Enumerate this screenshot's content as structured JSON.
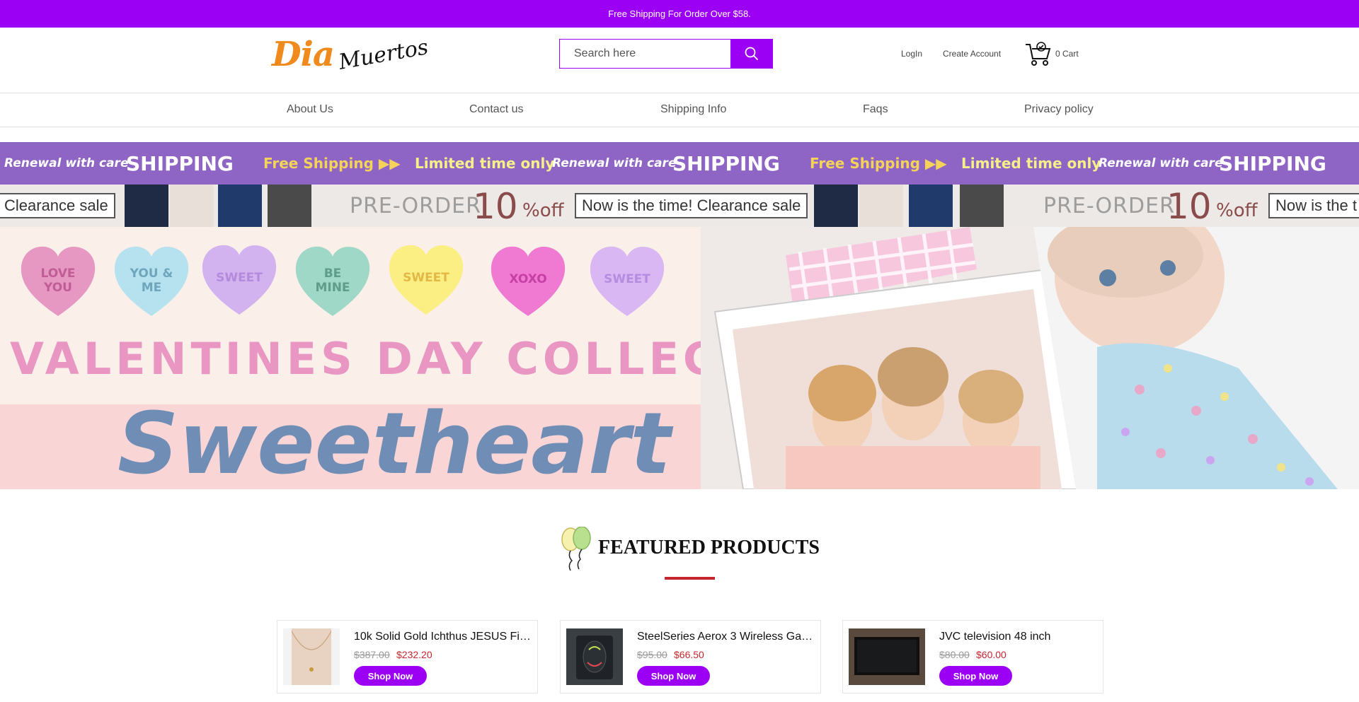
{
  "topbar": {
    "text": "Free Shipping For Order Over $58."
  },
  "logo": {
    "part1": "Dia",
    "part2": "Muertos"
  },
  "search": {
    "placeholder": "Search here",
    "icon": "search-icon"
  },
  "account": {
    "login": "LogIn",
    "create": "Create Account",
    "cart": "0 Cart"
  },
  "nav": [
    "About Us",
    "Contact us",
    "Shipping Info",
    "Faqs",
    "Privacy policy"
  ],
  "promo_strip": {
    "renewal": "Renewal with care",
    "shipping": "SHIPPING",
    "free_shipping": "Free Shipping ▶▶",
    "limited": "Limited time only"
  },
  "sale_strip": {
    "clearance": "Clearance sale",
    "preorder": "PRE-ORDER",
    "percent": "10",
    "off": "%off",
    "now": "Now is the time! Clearance sale",
    "now_cut": "Now is the t"
  },
  "hero": {
    "hearts": [
      {
        "text": "LOVE\nYOU",
        "color": "#e697c2",
        "text_color": "#c15d95"
      },
      {
        "text": "YOU &\nME",
        "color": "#b6e1ee",
        "text_color": "#6ea7bd"
      },
      {
        "text": "SWEET",
        "color": "#d3b2f0",
        "text_color": "#b48adb"
      },
      {
        "text": "BE\nMINE",
        "color": "#9fd8c6",
        "text_color": "#5f9c8a"
      },
      {
        "text": "SWEET",
        "color": "#fbee82",
        "text_color": "#e4b847"
      },
      {
        "text": "XOXO",
        "color": "#f07ad1",
        "text_color": "#c53fa5"
      },
      {
        "text": "SWEET",
        "color": "#d8b7f2",
        "text_color": "#b58ce0"
      }
    ],
    "headline": "VALENTINES DAY COLLECTION",
    "script": "Sweetheart"
  },
  "featured": {
    "title": "FEATURED PRODUCTS"
  },
  "products": [
    {
      "name": "10k Solid Gold Ichthus JESUS Fi…",
      "old_price": "$387.00",
      "new_price": "$232.20",
      "button": "Shop Now"
    },
    {
      "name": "SteelSeries Aerox 3 Wireless Ga…",
      "old_price": "$95.00",
      "new_price": "$66.50",
      "button": "Shop Now"
    },
    {
      "name": "JVC television 48 inch",
      "old_price": "$80.00",
      "new_price": "$60.00",
      "button": "Shop Now"
    }
  ],
  "colors": {
    "brand": "#9b00f5",
    "accent_red": "#c6262e",
    "promo_purple": "#8e64c4"
  }
}
